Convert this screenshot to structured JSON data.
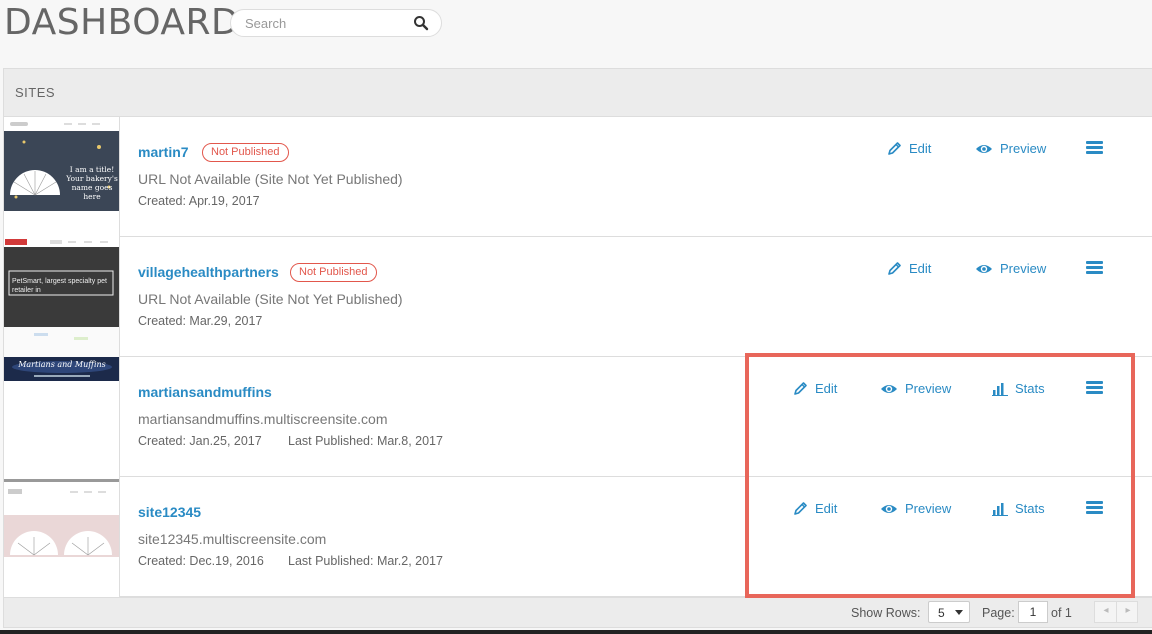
{
  "header": {
    "title": "DASHBOARD",
    "search_placeholder": "Search"
  },
  "panel": {
    "title": "SITES"
  },
  "actions": {
    "edit": "Edit",
    "preview": "Preview",
    "stats": "Stats"
  },
  "sites": [
    {
      "name": "martin7",
      "status_badge": "Not Published",
      "url": "URL Not Available (Site Not Yet Published)",
      "created": "Created: Apr.19, 2017",
      "thumbnail_text": "I am a title! Your bakery's name goes here"
    },
    {
      "name": "villagehealthpartners",
      "status_badge": "Not Published",
      "url": "URL Not Available (Site Not Yet Published)",
      "created": "Created: Mar.29, 2017",
      "thumbnail_text": "PetSmart, largest specialty pet retailer in"
    },
    {
      "name": "martiansandmuffins",
      "url": "martiansandmuffins.multiscreensite.com",
      "created": "Created: Jan.25, 2017",
      "last_published": "Last Published: Mar.8, 2017",
      "thumbnail_text": "Martians and Muffins"
    },
    {
      "name": "site12345",
      "url": "site12345.multiscreensite.com",
      "created": "Created: Dec.19, 2016",
      "last_published": "Last Published: Mar.2, 2017"
    }
  ],
  "pagination": {
    "show_rows_label": "Show Rows:",
    "rows_value": "5",
    "page_label": "Page:",
    "page_value": "1",
    "of_label": "of 1",
    "prev_symbol": "◂",
    "next_symbol": "▸"
  },
  "colors": {
    "accent": "#2a8bc4",
    "badge": "#e2574c",
    "highlight": "#e8665a"
  },
  "icons": [
    "search-icon",
    "pencil-icon",
    "eye-icon",
    "bar-chart-icon",
    "hamburger-menu-icon",
    "caret-down-icon"
  ]
}
